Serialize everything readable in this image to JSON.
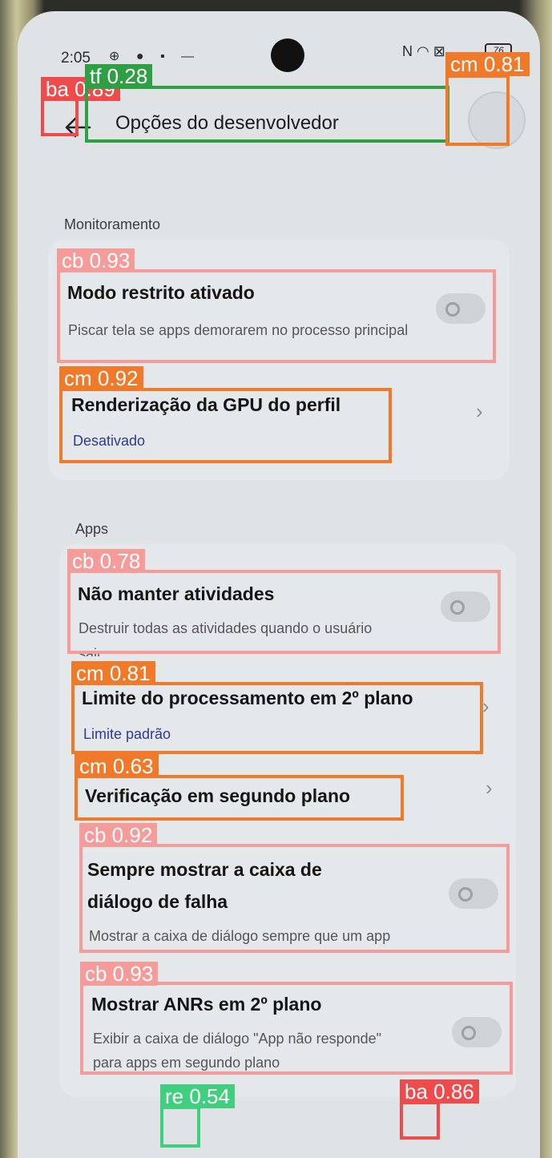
{
  "status_bar": {
    "time": "2:05",
    "battery": "76"
  },
  "header": {
    "title": "Opções do desenvolvedor"
  },
  "sections": [
    {
      "label": "Monitoramento",
      "items": [
        {
          "title": "Modo restrito ativado",
          "subtitle": "Piscar tela se apps demorarem no processo principal",
          "type": "toggle",
          "on": false
        },
        {
          "title": "Renderização da GPU do perfil",
          "value": "Desativado",
          "type": "chevron"
        }
      ]
    },
    {
      "label": "Apps",
      "items": [
        {
          "title": "Não manter atividades",
          "subtitle": "Destruir todas as atividades quando o usuário sair",
          "type": "toggle",
          "on": false
        },
        {
          "title": "Limite do processamento em 2º plano",
          "value": "Limite padrão",
          "type": "chevron"
        },
        {
          "title": "Verificação em segundo plano",
          "type": "chevron"
        },
        {
          "title_line1": "Sempre mostrar a caixa de",
          "title_line2": "diálogo de falha",
          "subtitle": "Mostrar a caixa de diálogo sempre que um app falha",
          "type": "toggle",
          "on": false
        },
        {
          "title": "Mostrar ANRs em 2º plano",
          "subtitle_line1": "Exibir a caixa de diálogo \"App não responde\"",
          "subtitle_line2": "para apps em segundo plano",
          "type": "toggle",
          "on": false
        }
      ]
    }
  ],
  "detections": [
    {
      "label": "ba 0.89",
      "color": "#ef4b4b"
    },
    {
      "label": "tf 0.28",
      "color": "#2ea043"
    },
    {
      "label": "cm 0.81",
      "color": "#f07a2a"
    },
    {
      "label": "cb 0.93",
      "color": "#f59c9a"
    },
    {
      "label": "cm 0.92",
      "color": "#f07a2a"
    },
    {
      "label": "cb 0.78",
      "color": "#f59c9a"
    },
    {
      "label": "cm 0.81",
      "color": "#f07a2a"
    },
    {
      "label": "cm 0.63",
      "color": "#f07a2a"
    },
    {
      "label": "cb 0.92",
      "color": "#f59c9a"
    },
    {
      "label": "cb 0.93",
      "color": "#f59c9a"
    },
    {
      "label": "re 0.54",
      "color": "#3fcf7f"
    },
    {
      "label": "ba 0.86",
      "color": "#ef4b4b"
    }
  ],
  "icons": {
    "back": "arrow-left-icon",
    "chevron": "chevron-right-icon",
    "wifi": "wifi-icon",
    "nfc": "nfc-icon"
  }
}
